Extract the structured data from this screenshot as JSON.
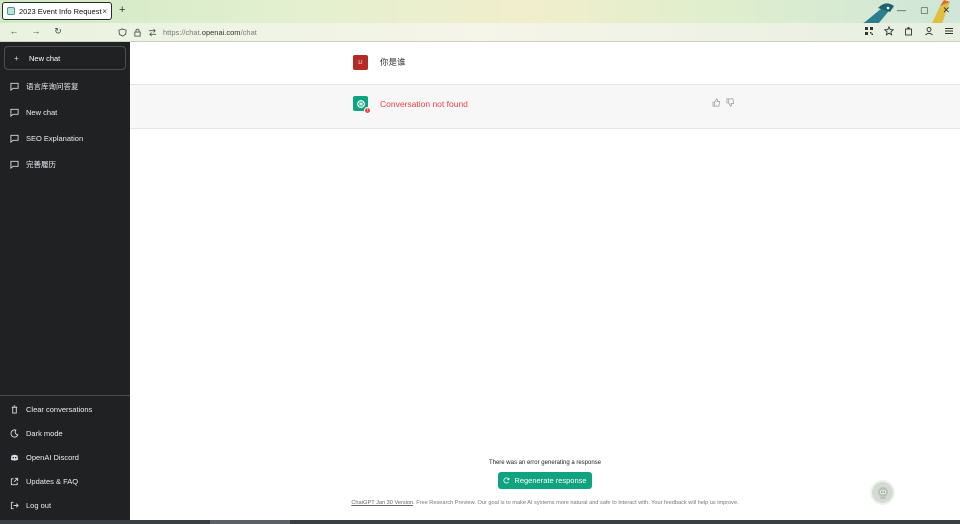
{
  "browser": {
    "tab_title": "2023 Event Info Request",
    "tab_close": "×",
    "new_tab": "+",
    "url_prefix": "https://chat.",
    "url_host": "openai.com",
    "url_path": "/chat",
    "nav_back": "←",
    "nav_forward": "→",
    "nav_reload": "↻",
    "win_min": "—",
    "win_max": "▢",
    "win_close": "✕"
  },
  "sidebar": {
    "new_chat": "New chat",
    "conversations": [
      {
        "label": "语言库询问答复"
      },
      {
        "label": "New chat"
      },
      {
        "label": "SEO Explanation"
      },
      {
        "label": "完善履历"
      }
    ],
    "bottom": {
      "clear": "Clear conversations",
      "dark": "Dark mode",
      "discord": "OpenAI Discord",
      "faq": "Updates & FAQ",
      "logout": "Log out"
    }
  },
  "chat": {
    "user_avatar_text": "LI",
    "user_message": "你是谁",
    "error_badge": "!",
    "assistant_error": "Conversation not found",
    "error_note": "There was an error generating a response",
    "regenerate_label": "Regenerate response",
    "footer_version": "ChatGPT Jan 30 Version",
    "footer_text": ". Free Research Preview. Our goal is to make AI systems more natural and safe to interact with. Your feedback will help us improve."
  },
  "colors": {
    "sidebar_bg": "#202123",
    "accent": "#10a37f",
    "error": "#ef4146",
    "user_avatar": "#b42a24"
  }
}
